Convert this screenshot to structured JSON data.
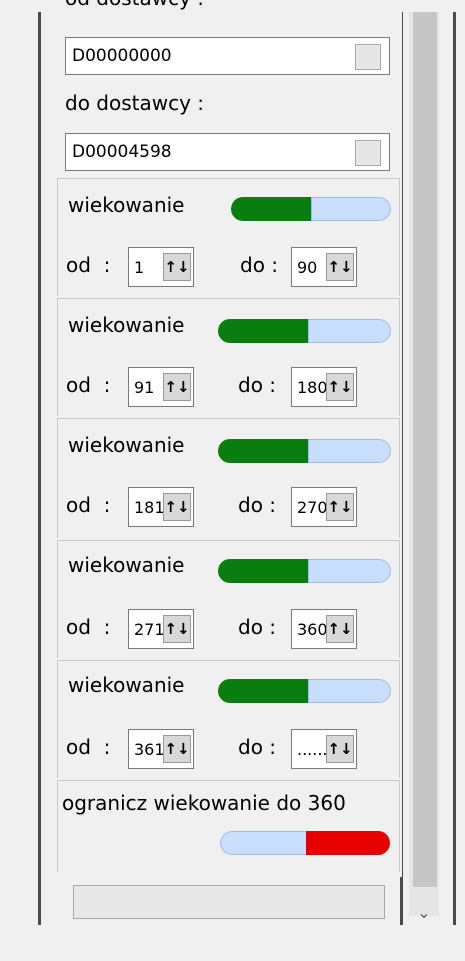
{
  "supplier": {
    "from_label_cut": "od dostawcy :",
    "from_value": "D00000000",
    "to_label": "do dostawcy :",
    "to_value": "D00004598"
  },
  "aging_groups": [
    {
      "label": "wiekowanie",
      "from_label": "od",
      "from_value": "1",
      "to_label": "do :",
      "to_value": "90",
      "enabled": true
    },
    {
      "label": "wiekowanie",
      "from_label": "od",
      "from_value": "91",
      "to_label": "do :",
      "to_value": "180",
      "enabled": true
    },
    {
      "label": "wiekowanie",
      "from_label": "od",
      "from_value": "181",
      "to_label": "do :",
      "to_value": "270",
      "enabled": true
    },
    {
      "label": "wiekowanie",
      "from_label": "od",
      "from_value": "271",
      "to_label": "do :",
      "to_value": "360",
      "enabled": true
    },
    {
      "label": "wiekowanie",
      "from_label": "od",
      "from_value": "361",
      "to_label": "do :",
      "to_value": "......",
      "enabled": true
    }
  ],
  "limit": {
    "label": "ogranicz wiekowanie do 360",
    "enabled": false
  },
  "colors": {
    "toggle_on": "#0a7d10",
    "toggle_off": "#c8defc",
    "limit_off_red": "#e60000"
  },
  "icons": {
    "spin_arrows": "up-down-arrows-icon",
    "scroll_down": "chevron-down-icon"
  }
}
